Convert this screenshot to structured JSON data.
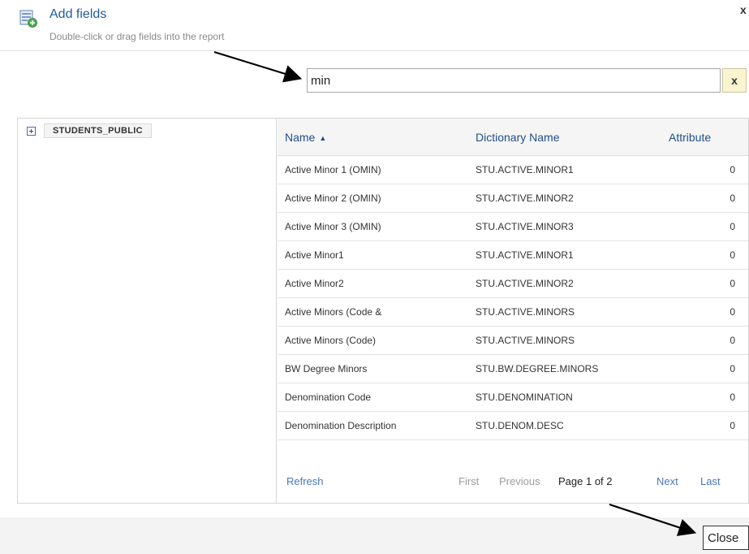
{
  "dialog": {
    "title": "Add fields",
    "subtitle": "Double-click or drag fields into the report",
    "close_x": "x",
    "icon": "add-fields-icon"
  },
  "search": {
    "value": "min",
    "clear_label": "x"
  },
  "tree": {
    "root_label": "STUDENTS_PUBLIC",
    "expand_icon": "plus-box-icon"
  },
  "grid": {
    "columns": {
      "name": "Name",
      "dictionary": "Dictionary Name",
      "attribute": "Attribute"
    },
    "sort": {
      "column": "name",
      "direction": "ascending"
    },
    "rows": [
      {
        "name": "Active Minor 1 (OMIN)",
        "dictionary": "STU.ACTIVE.MINOR1",
        "attribute": "0"
      },
      {
        "name": "Active Minor 2 (OMIN)",
        "dictionary": "STU.ACTIVE.MINOR2",
        "attribute": "0"
      },
      {
        "name": "Active Minor 3 (OMIN)",
        "dictionary": "STU.ACTIVE.MINOR3",
        "attribute": "0"
      },
      {
        "name": "Active Minor1",
        "dictionary": "STU.ACTIVE.MINOR1",
        "attribute": "0"
      },
      {
        "name": "Active Minor2",
        "dictionary": "STU.ACTIVE.MINOR2",
        "attribute": "0"
      },
      {
        "name": "Active Minors (Code &",
        "dictionary": "STU.ACTIVE.MINORS",
        "attribute": "0"
      },
      {
        "name": "Active Minors (Code)",
        "dictionary": "STU.ACTIVE.MINORS",
        "attribute": "0"
      },
      {
        "name": "BW Degree Minors",
        "dictionary": "STU.BW.DEGREE.MINORS",
        "attribute": "0"
      },
      {
        "name": "Denomination Code",
        "dictionary": "STU.DENOMINATION",
        "attribute": "0"
      },
      {
        "name": "Denomination Description",
        "dictionary": "STU.DENOM.DESC",
        "attribute": "0"
      }
    ]
  },
  "pager": {
    "refresh": "Refresh",
    "first": "First",
    "previous": "Previous",
    "page_info": "Page 1 of 2",
    "next": "Next",
    "last": "Last"
  },
  "footer": {
    "close_label": "Close"
  },
  "colors": {
    "link": "#4a79b8",
    "title": "#1f5a9e",
    "header_bg": "#f5f5f5",
    "clear_bg": "#fbf5cf"
  }
}
